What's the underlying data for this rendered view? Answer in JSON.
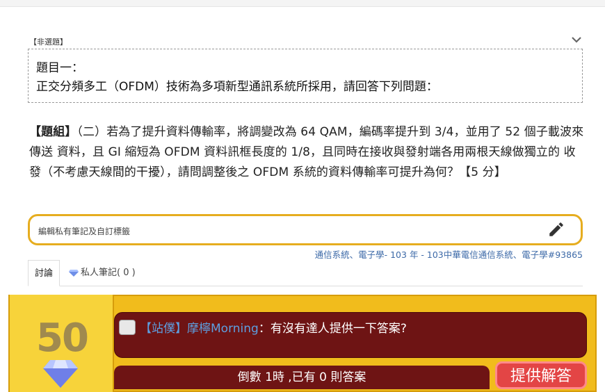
{
  "question": {
    "tag": "【非選題】",
    "title_line1": "題目一：",
    "title_line2": "正交分頻多工（OFDM）技術為多項新型通訊系統所採用，請回答下列問題：",
    "group_label": "【題組】",
    "group_text": "（二）若為了提升資料傳輸率，將調變改為 64 QAM，編碼率提升到 3/4，並用了 52 個子載波來傳送 資料，且 GI 縮短為 OFDM 資料訊框長度的 1/8，且同時在接收與發射端各用兩根天線做獨立的 收發（不考慮天線間的干擾），請問調整後之 OFDM 系統的資料傳輸率可提升為何？【5 分】"
  },
  "notes": {
    "placeholder": "編輯私有筆記及自訂標籤",
    "edit_icon": "pencil-icon"
  },
  "breadcrumb": "通信系統、電子學- 103 年 - 103中華電信通信系統、電子學#93865",
  "tabs": {
    "discussion": "討論",
    "private_notes": "私人筆記( 0 )"
  },
  "reward": {
    "points": "50",
    "icon": "diamond-icon"
  },
  "post": {
    "author": "【站僕】摩檸Morning",
    "text": "：有沒有達人提供一下答案?"
  },
  "countdown": "倒數 1時 ,已有 0 則答案",
  "provide_button": "提供解答",
  "colors": {
    "gold": "#f1bc1c",
    "dark_red": "#6e1414",
    "link_blue": "#3d6aa8",
    "button_red": "#e34545"
  }
}
